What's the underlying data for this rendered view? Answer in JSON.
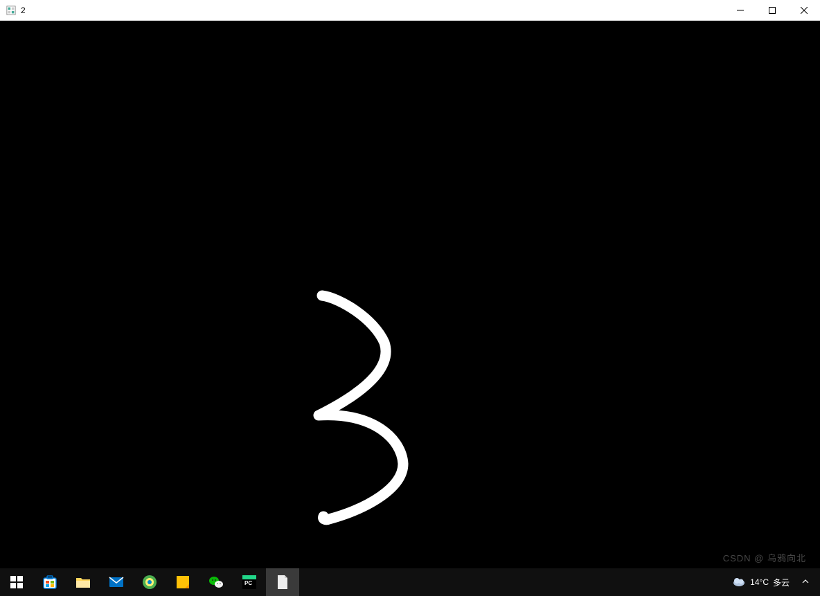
{
  "window": {
    "title": "2",
    "icon": "opencv-window-icon"
  },
  "controls": {
    "minimize": "minimize",
    "maximize": "maximize",
    "close": "close"
  },
  "canvas": {
    "background": "#000000",
    "stroke_color": "#ffffff",
    "drawn_digit": "3"
  },
  "taskbar": {
    "items": [
      {
        "name": "start",
        "label": "Start"
      },
      {
        "name": "store",
        "label": "Microsoft Store"
      },
      {
        "name": "explorer",
        "label": "File Explorer"
      },
      {
        "name": "mail",
        "label": "Mail"
      },
      {
        "name": "edge",
        "label": "Edge"
      },
      {
        "name": "sticky",
        "label": "Sticky Notes"
      },
      {
        "name": "wechat",
        "label": "WeChat"
      },
      {
        "name": "pycharm",
        "label": "PyCharm"
      },
      {
        "name": "notepad",
        "label": "Document",
        "active": true
      }
    ]
  },
  "systray": {
    "weather_icon": "cloud",
    "weather_temp": "14°C",
    "weather_desc": "多云",
    "show_hidden": "^"
  },
  "watermark": "CSDN @ 乌鸦向北"
}
